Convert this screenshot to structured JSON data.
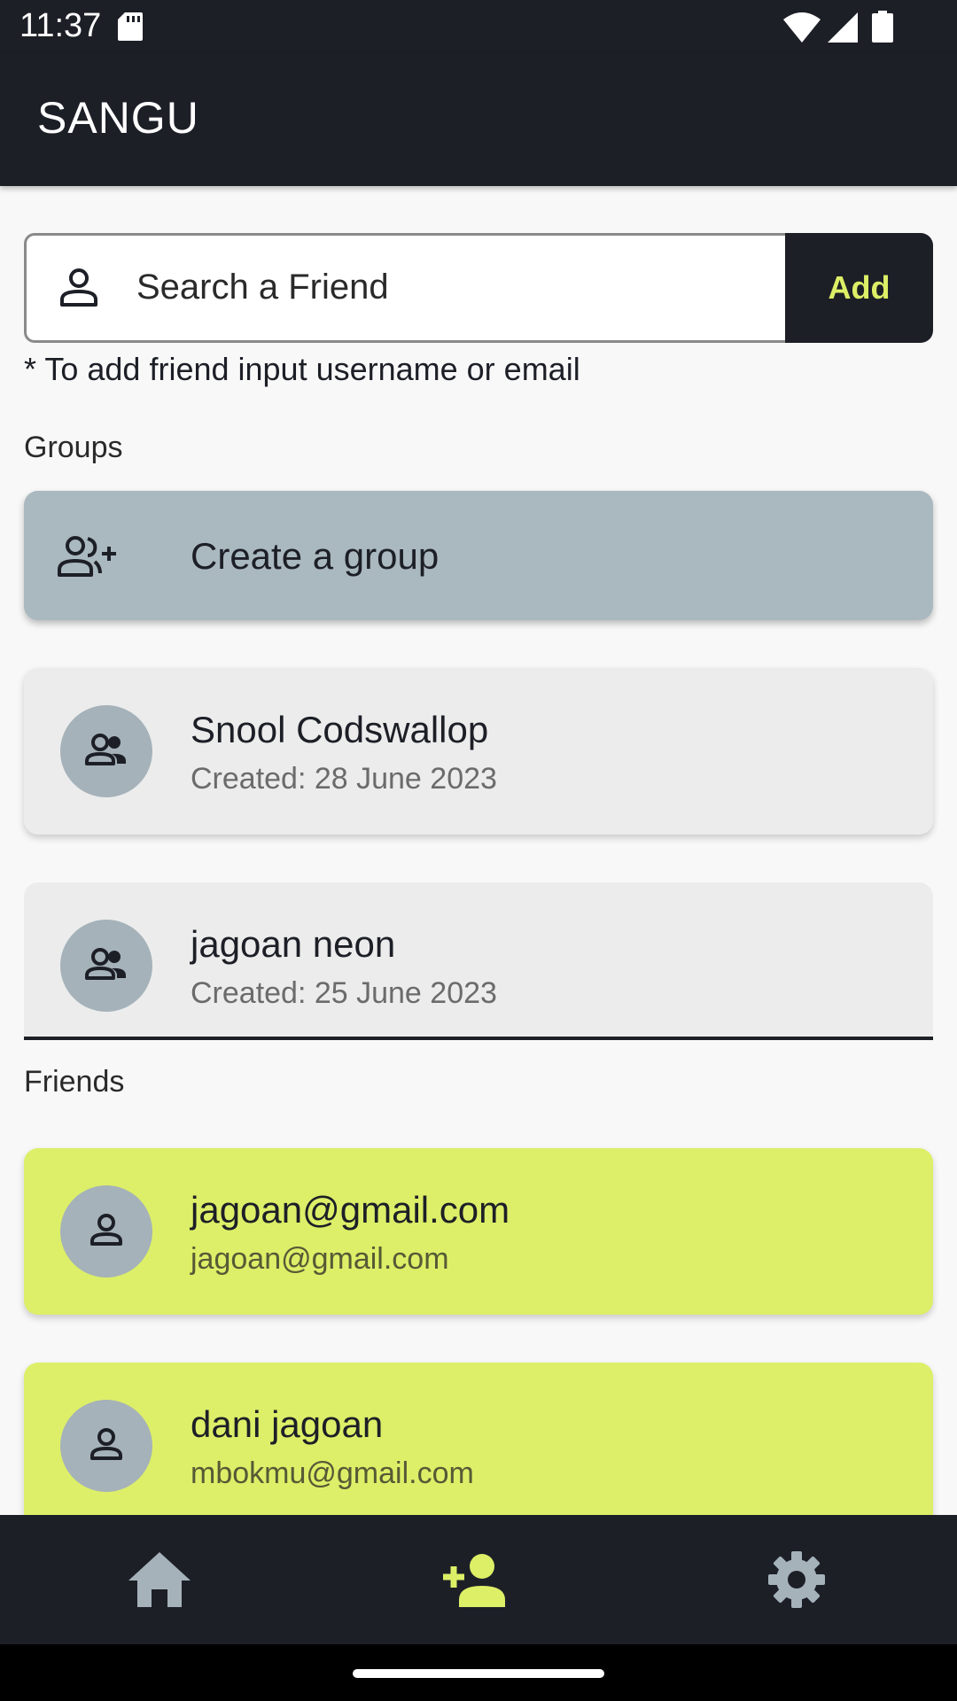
{
  "status_bar": {
    "time": "11:37"
  },
  "app_bar": {
    "title": "SANGU"
  },
  "search": {
    "placeholder": "Search a Friend",
    "add_label": "Add",
    "hint": "* To add friend input username or email"
  },
  "groups": {
    "section_label": "Groups",
    "create_label": "Create a group",
    "items": [
      {
        "name": "Snool Codswallop",
        "created": "Created: 28 June 2023"
      },
      {
        "name": "jagoan neon",
        "created": "Created: 25 June 2023"
      }
    ]
  },
  "friends": {
    "section_label": "Friends",
    "items": [
      {
        "name": "jagoan@gmail.com",
        "email": "jagoan@gmail.com"
      },
      {
        "name": "dani jagoan",
        "email": "mbokmu@gmail.com"
      }
    ]
  },
  "bottom_nav": {
    "items": [
      {
        "icon": "home-icon",
        "active": false
      },
      {
        "icon": "person-add-icon",
        "active": true
      },
      {
        "icon": "gear-icon",
        "active": false
      }
    ]
  },
  "colors": {
    "dark": "#1d1f27",
    "accent": "#dcef66",
    "create_card": "#aab8bf",
    "group_card": "#ececec",
    "friend_card": "#ddef68",
    "inactive_icon": "#a5b2b9"
  }
}
